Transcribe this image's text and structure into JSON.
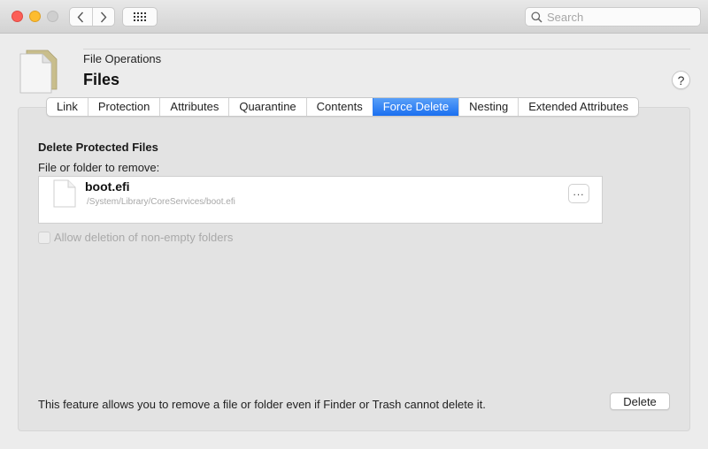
{
  "titlebar": {
    "back_icon": "chevron-left",
    "forward_icon": "chevron-right",
    "grid_icon": "grid-dots",
    "search_placeholder": "Search",
    "search_value": ""
  },
  "header": {
    "subtitle": "File Operations",
    "title": "Files",
    "help_label": "?"
  },
  "tabs": [
    {
      "label": "Link",
      "active": false
    },
    {
      "label": "Protection",
      "active": false
    },
    {
      "label": "Attributes",
      "active": false
    },
    {
      "label": "Quarantine",
      "active": false
    },
    {
      "label": "Contents",
      "active": false
    },
    {
      "label": "Force Delete",
      "active": true
    },
    {
      "label": "Nesting",
      "active": false
    },
    {
      "label": "Extended Attributes",
      "active": false
    }
  ],
  "content": {
    "section_title": "Delete Protected Files",
    "field_label": "File or folder to remove:",
    "file": {
      "name": "boot.efi",
      "path": "/System/Library/CoreServices/boot.efi"
    },
    "browse_label": "...",
    "checkbox_label": "Allow deletion of non-empty folders",
    "checkbox_checked": false,
    "checkbox_enabled": false,
    "footer_text": "This feature allows you to remove a file or folder even if Finder or Trash cannot delete it.",
    "delete_label": "Delete"
  },
  "colors": {
    "accent": "#1a6ff0",
    "close": "#fc5f57",
    "minimize": "#fdbc2e"
  }
}
